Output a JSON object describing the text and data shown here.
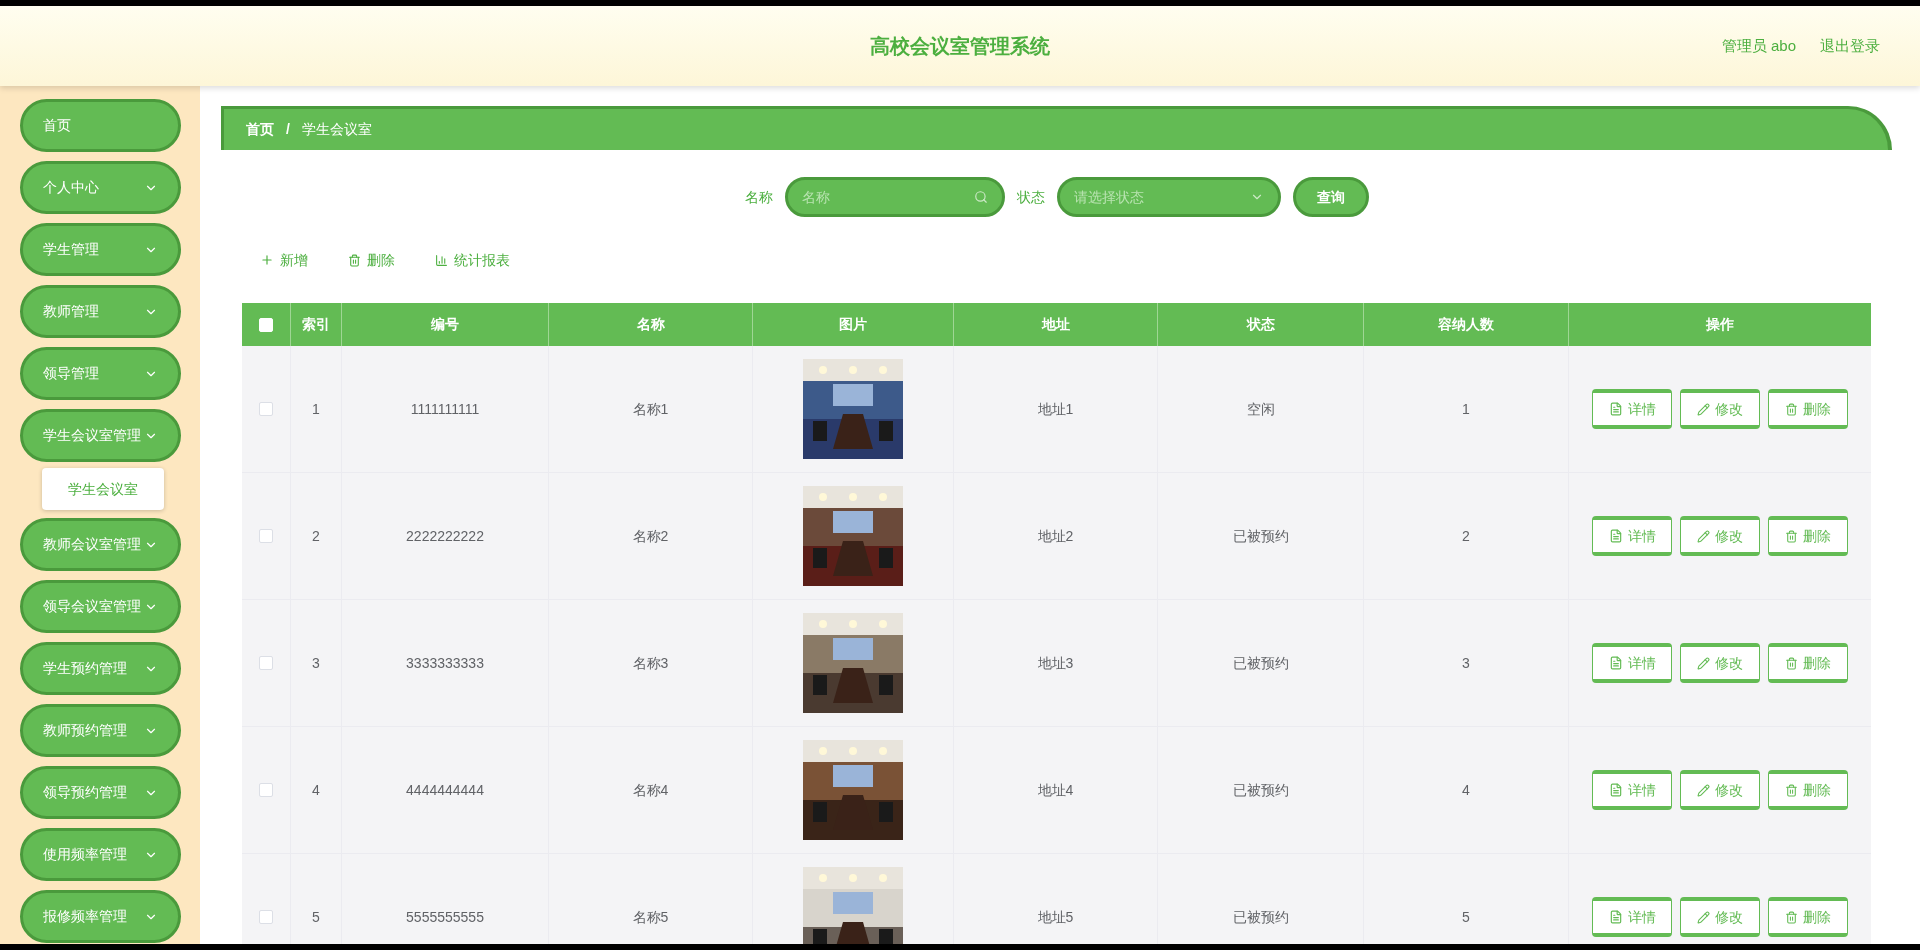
{
  "header": {
    "title": "高校会议室管理系统",
    "user": "管理员 abo",
    "logout": "退出登录"
  },
  "sidebar": {
    "items": [
      {
        "label": "首页",
        "has_arrow": false
      },
      {
        "label": "个人中心",
        "has_arrow": true
      },
      {
        "label": "学生管理",
        "has_arrow": true
      },
      {
        "label": "教师管理",
        "has_arrow": true
      },
      {
        "label": "领导管理",
        "has_arrow": true
      },
      {
        "label": "学生会议室管理",
        "has_arrow": true,
        "children": [
          {
            "label": "学生会议室"
          }
        ]
      },
      {
        "label": "教师会议室管理",
        "has_arrow": true
      },
      {
        "label": "领导会议室管理",
        "has_arrow": true
      },
      {
        "label": "学生预约管理",
        "has_arrow": true
      },
      {
        "label": "教师预约管理",
        "has_arrow": true
      },
      {
        "label": "领导预约管理",
        "has_arrow": true
      },
      {
        "label": "使用频率管理",
        "has_arrow": true
      },
      {
        "label": "报修频率管理",
        "has_arrow": true
      }
    ]
  },
  "breadcrumb": {
    "items": [
      "首页",
      "学生会议室"
    ],
    "separator": "/"
  },
  "search": {
    "name_label": "名称",
    "name_placeholder": "名称",
    "status_label": "状态",
    "status_placeholder": "请选择状态",
    "button": "查询"
  },
  "toolbar": [
    {
      "kind": "add",
      "label": "新增"
    },
    {
      "kind": "delete",
      "label": "删除"
    },
    {
      "kind": "chart",
      "label": "统计报表"
    }
  ],
  "table": {
    "header_checked": false,
    "columns": [
      "索引",
      "编号",
      "名称",
      "图片",
      "地址",
      "状态",
      "容纳人数",
      "操作"
    ],
    "rows": [
      {
        "checked": false,
        "index": "1",
        "code": "1111111111",
        "name": "名称1",
        "address": "地址1",
        "status": "空闲",
        "capacity": "1",
        "actions": [
          "详情",
          "修改",
          "删除"
        ]
      },
      {
        "checked": false,
        "index": "2",
        "code": "2222222222",
        "name": "名称2",
        "address": "地址2",
        "status": "已被预约",
        "capacity": "2",
        "actions": [
          "详情",
          "修改",
          "删除"
        ]
      },
      {
        "checked": false,
        "index": "3",
        "code": "3333333333",
        "name": "名称3",
        "address": "地址3",
        "status": "已被预约",
        "capacity": "3",
        "actions": [
          "详情",
          "修改",
          "删除"
        ]
      },
      {
        "checked": false,
        "index": "4",
        "code": "4444444444",
        "name": "名称4",
        "address": "地址4",
        "status": "已被预约",
        "capacity": "4",
        "actions": [
          "详情",
          "修改",
          "删除"
        ]
      },
      {
        "checked": false,
        "index": "5",
        "code": "5555555555",
        "name": "名称5",
        "address": "地址5",
        "status": "已被预约",
        "capacity": "5",
        "actions": [
          "详情",
          "修改",
          "删除"
        ]
      }
    ]
  }
}
